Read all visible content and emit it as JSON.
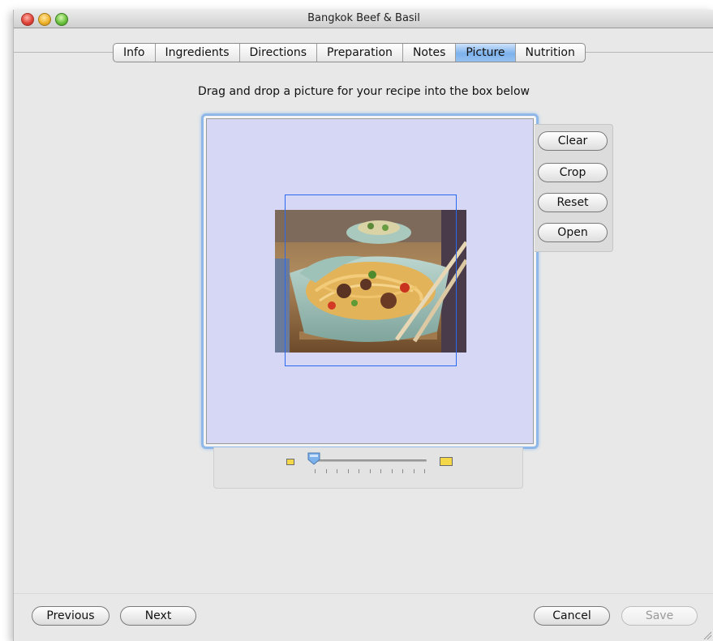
{
  "window": {
    "title": "Bangkok Beef & Basil"
  },
  "tabs": [
    {
      "label": "Info"
    },
    {
      "label": "Ingredients"
    },
    {
      "label": "Directions"
    },
    {
      "label": "Preparation"
    },
    {
      "label": "Notes"
    },
    {
      "label": "Picture",
      "active": true
    },
    {
      "label": "Nutrition"
    }
  ],
  "picture": {
    "instructions": "Drag and drop a picture for your recipe into the box below",
    "buttons": {
      "clear": "Clear",
      "crop": "Crop",
      "reset": "Reset",
      "open": "Open"
    },
    "zoom_slider": {
      "value": 0.0,
      "tick_count": 11,
      "min_icon": "small-image-icon",
      "max_icon": "large-image-icon"
    }
  },
  "footer": {
    "previous": "Previous",
    "next": "Next",
    "cancel": "Cancel",
    "save": "Save"
  },
  "colors": {
    "active_tab": "#7cb1ec",
    "drop_area": "#d6d6f5",
    "crop_frame": "#2a6af0",
    "focus_ring": "#8fb8e8"
  }
}
